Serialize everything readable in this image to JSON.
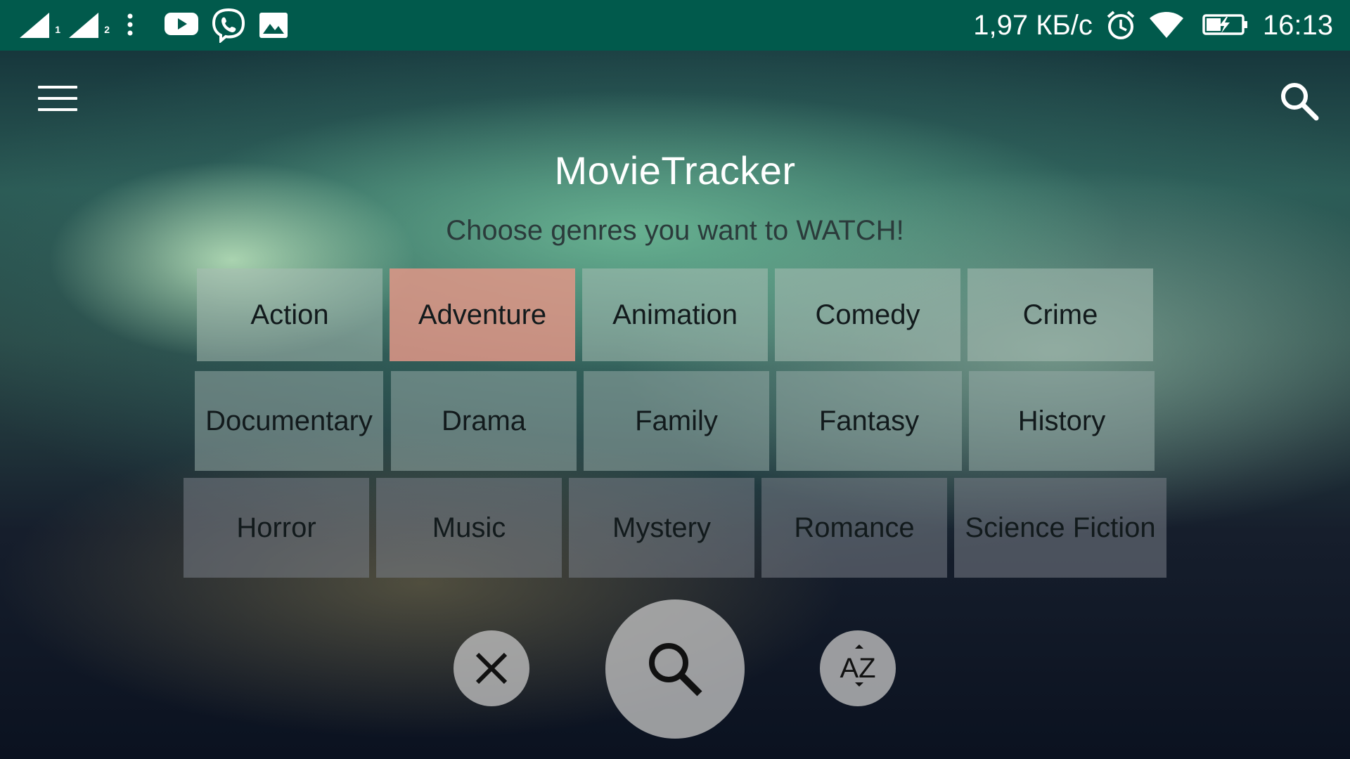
{
  "status_bar": {
    "network_speed": "1,97 КБ/с",
    "time": "16:13",
    "sim1_label": "1",
    "sim2_label": "2"
  },
  "app": {
    "title": "MovieTracker",
    "subtitle": "Choose genres you want to WATCH!"
  },
  "genres": [
    {
      "label": "Action",
      "selected": false
    },
    {
      "label": "Adventure",
      "selected": true
    },
    {
      "label": "Animation",
      "selected": false
    },
    {
      "label": "Comedy",
      "selected": false
    },
    {
      "label": "Crime",
      "selected": false
    },
    {
      "label": "Documentary",
      "selected": false
    },
    {
      "label": "Drama",
      "selected": false
    },
    {
      "label": "Family",
      "selected": false
    },
    {
      "label": "Fantasy",
      "selected": false
    },
    {
      "label": "History",
      "selected": false
    },
    {
      "label": "Horror",
      "selected": false
    },
    {
      "label": "Music",
      "selected": false
    },
    {
      "label": "Mystery",
      "selected": false
    },
    {
      "label": "Romance",
      "selected": false
    },
    {
      "label": "Science Fiction",
      "selected": false
    }
  ],
  "sort_button": {
    "label": "AZ"
  },
  "colors": {
    "status_bar": "#015a4c",
    "selected_genre": "#e19687",
    "fab": "#bebebe"
  }
}
